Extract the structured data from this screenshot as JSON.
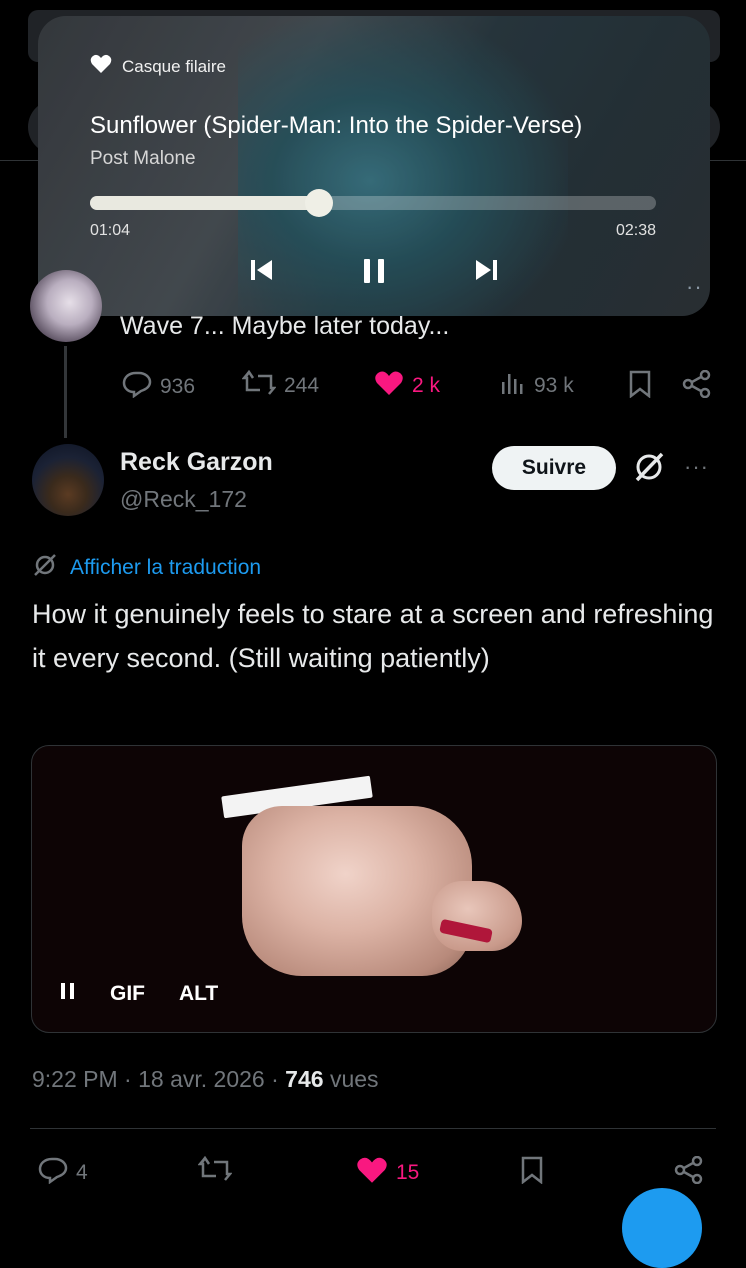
{
  "player": {
    "source": "Casque filaire",
    "title": "Sunflower (Spider-Man: Into the Spider-Verse)",
    "artist": "Post Malone",
    "elapsed": "01:04",
    "duration": "02:38",
    "progress": 0.405,
    "icons": [
      "headphones-icon",
      "previous-icon",
      "pause-icon",
      "next-icon"
    ]
  },
  "tweet1": {
    "text": "Wave 7... Maybe later today...",
    "replies": "936",
    "retweets": "244",
    "likes": "2 k",
    "views": "93 k",
    "like_color": "#f91880"
  },
  "tweet2": {
    "name": "Reck Garzon",
    "handle": "@Reck_172",
    "follow_label": "Suivre",
    "translate_label": "Afficher la traduction",
    "text": "How it genuinely feels to stare at a screen and refreshing it every second. (Still waiting patiently)",
    "media": {
      "gif_label": "GIF",
      "alt_label": "ALT"
    },
    "time": "9:22 PM",
    "date": "18 avr. 2026",
    "views_count": "746",
    "views_label": "vues",
    "replies": "4",
    "likes": "15",
    "accent_color": "#1d9bf0"
  }
}
